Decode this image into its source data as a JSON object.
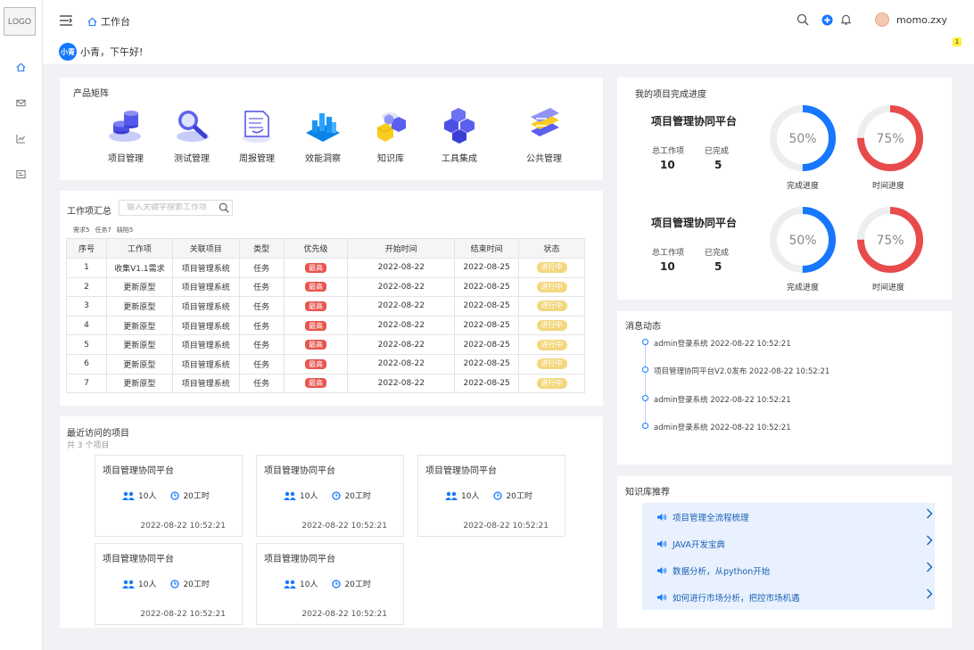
{
  "app": {
    "logo_text": "LOGO",
    "breadcrumb": "工作台",
    "username": "momo.zxy",
    "notice_count": "1",
    "greeting_avatar": "小青",
    "greeting": "小青，下午好!"
  },
  "products": {
    "title": "产品矩阵",
    "items": [
      {
        "label": "项目管理",
        "icon": "coin-stack-icon"
      },
      {
        "label": "测试管理",
        "icon": "magnifier-icon"
      },
      {
        "label": "周报管理",
        "icon": "report-doc-icon"
      },
      {
        "label": "效能洞察",
        "icon": "bar-chart-icon"
      },
      {
        "label": "知识库",
        "icon": "cubes-icon"
      },
      {
        "label": "工具集成",
        "icon": "toolbox-icon"
      },
      {
        "label": "公共管理",
        "icon": "layers-icon"
      }
    ]
  },
  "workitems": {
    "title": "工作项汇总",
    "search_placeholder": "输入关键字搜索工作项",
    "counts": {
      "req": "需求5",
      "task": "任务7",
      "bug": "缺陷5"
    },
    "columns": [
      "序号",
      "工作项",
      "关联项目",
      "类型",
      "优先级",
      "开始时间",
      "结束时间",
      "状态"
    ],
    "rows": [
      [
        "1",
        "收集V1.1需求",
        "项目管理系统",
        "任务",
        "最高",
        "2022-08-22",
        "2022-08-25",
        "进行中"
      ],
      [
        "2",
        "更新原型",
        "项目管理系统",
        "任务",
        "最高",
        "2022-08-22",
        "2022-08-25",
        "进行中"
      ],
      [
        "3",
        "更新原型",
        "项目管理系统",
        "任务",
        "最高",
        "2022-08-22",
        "2022-08-25",
        "进行中"
      ],
      [
        "4",
        "更新原型",
        "项目管理系统",
        "任务",
        "最高",
        "2022-08-22",
        "2022-08-25",
        "进行中"
      ],
      [
        "5",
        "更新原型",
        "项目管理系统",
        "任务",
        "最高",
        "2022-08-22",
        "2022-08-25",
        "进行中"
      ],
      [
        "6",
        "更新原型",
        "项目管理系统",
        "任务",
        "最高",
        "2022-08-22",
        "2022-08-25",
        "进行中"
      ],
      [
        "7",
        "更新原型",
        "项目管理系统",
        "任务",
        "最高",
        "2022-08-22",
        "2022-08-25",
        "进行中"
      ]
    ]
  },
  "recent": {
    "title": "最近访问的项目",
    "subtitle": "共 3 个项目",
    "items": [
      {
        "name": "项目管理协同平台",
        "people": "10人",
        "hours": "20工时",
        "time": "2022-08-22 10:52:21"
      },
      {
        "name": "项目管理协同平台",
        "people": "10人",
        "hours": "20工时",
        "time": "2022-08-22 10:52:21"
      },
      {
        "name": "项目管理协同平台",
        "people": "10人",
        "hours": "20工时",
        "time": "2022-08-22 10:52:21"
      },
      {
        "name": "项目管理协同平台",
        "people": "10人",
        "hours": "20工时",
        "time": "2022-08-22 10:52:21"
      },
      {
        "name": "项目管理协同平台",
        "people": "10人",
        "hours": "20工时",
        "time": "2022-08-22 10:52:21"
      }
    ]
  },
  "progress": {
    "title": "我的项目完成进度",
    "items": [
      {
        "name": "项目管理协同平台",
        "total_label": "总工作项",
        "total": "10",
        "done_label": "已完成",
        "done": "5",
        "completion_pct": 50,
        "completion_text": "50%",
        "completion_label": "完成进度",
        "time_pct": 75,
        "time_text": "75%",
        "time_label": "时间进度"
      },
      {
        "name": "项目管理协同平台",
        "total_label": "总工作项",
        "total": "10",
        "done_label": "已完成",
        "done": "5",
        "completion_pct": 50,
        "completion_text": "50%",
        "completion_label": "完成进度",
        "time_pct": 75,
        "time_text": "75%",
        "time_label": "时间进度"
      }
    ],
    "colors": {
      "completion": "#1677ff",
      "time": "#e84b4b",
      "track": "#eceef0"
    }
  },
  "messages": {
    "title": "消息动态",
    "items": [
      "admin登录系统 2022-08-22 10:52:21",
      "项目管理协同平台V2.0发布 2022-08-22 10:52:21",
      "admin登录系统 2022-08-22 10:52:21",
      "admin登录系统 2022-08-22 10:52:21"
    ]
  },
  "knowledge": {
    "title": "知识库推荐",
    "items": [
      "项目管理全流程梳理",
      "JAVA开发宝典",
      "数据分析，从python开始",
      "如何进行市场分析，把控市场机遇"
    ]
  }
}
